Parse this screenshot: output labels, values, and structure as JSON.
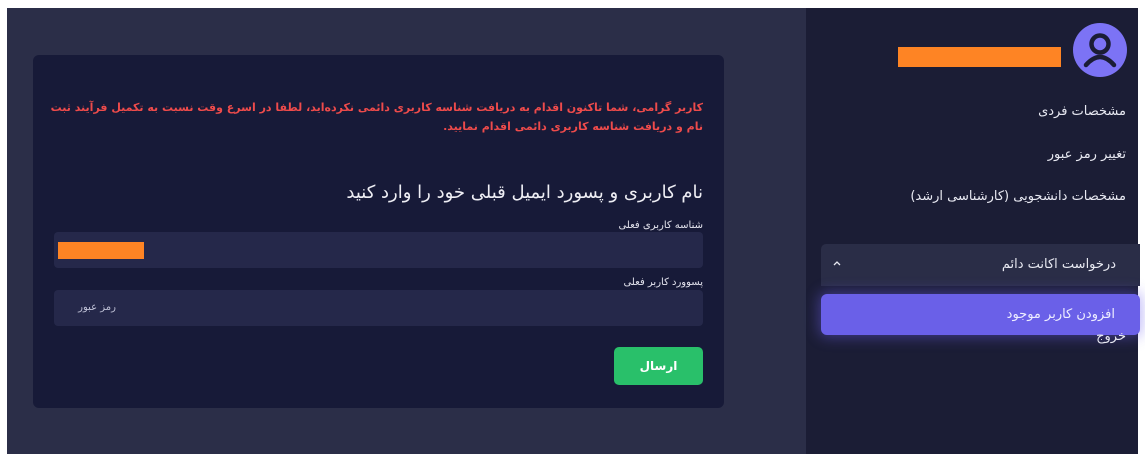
{
  "sidebar": {
    "items": [
      {
        "label": "مشخصات فردی"
      },
      {
        "label": "تغییر رمز عبور"
      },
      {
        "label": "مشخصات دانشجویی (کارشناسی ارشد)"
      },
      {
        "label": "درخواست اکانت دائم"
      },
      {
        "label": "افزودن کاربر موجود"
      },
      {
        "label": "خروج"
      }
    ],
    "active_index": 4,
    "expanded_item_index": 3
  },
  "form": {
    "warning": "کاربر گرامی، شما تاکنون اقدام به دریافت شناسه کاربری دائمی نکرده‌اید، لطفا در اسرع وقت نسبت به تکمیل فرآیند ثبت نام و دریافت شناسه کاربری دائمی اقدام نمایید.",
    "heading": "نام کاربری و پسورد ایمیل قبلی خود را وارد کنید",
    "username_label": "شناسه کاربری فعلی",
    "password_label": "پسوورد کاربر فعلی",
    "password_placeholder": "رمز عبور",
    "submit_label": "ارسال"
  },
  "colors": {
    "background": "#2b2e48",
    "sidebar": "#1b1d35",
    "card": "#171a38",
    "input": "#25284a",
    "accent": "#6a60e8",
    "avatar": "#7c73f5",
    "warning": "#ee4b4b",
    "success": "#29c06a",
    "redaction": "#fe8424"
  },
  "icons": {
    "avatar": "user-circle-icon",
    "chevron": "chevron-up-icon"
  }
}
